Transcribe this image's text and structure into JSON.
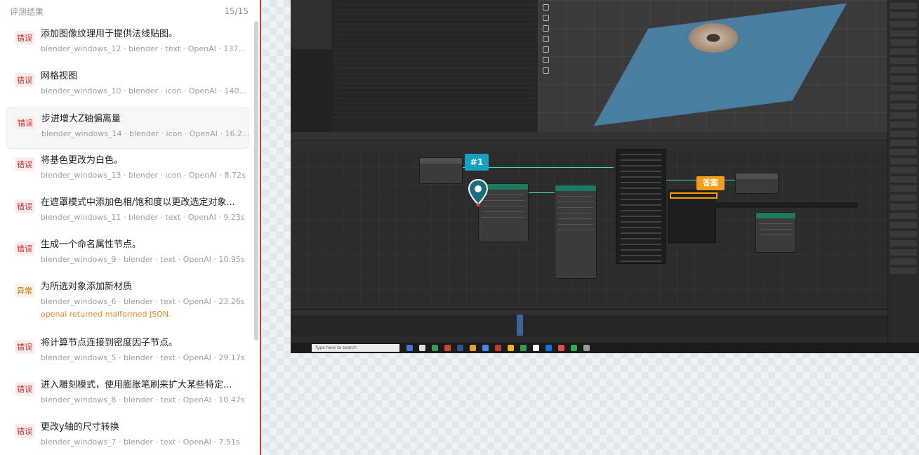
{
  "header": {
    "title": "评测结果",
    "count": "15/15"
  },
  "results": [
    {
      "status": "错误",
      "status_kind": "error",
      "title": "添加图像纹理用于提供法线贴图。",
      "meta": "blender_windows_12 · blender · text · OpenAI · 137...",
      "selected": false
    },
    {
      "status": "错误",
      "status_kind": "error",
      "title": "网格视图",
      "meta": "blender_windows_10 · blender · icon · OpenAI · 140...",
      "selected": false
    },
    {
      "status": "错误",
      "status_kind": "error",
      "title": "步进增大Z轴偏离量",
      "meta": "blender_windows_14 · blender · icon · OpenAI · 16.2...",
      "selected": true
    },
    {
      "status": "错误",
      "status_kind": "error",
      "title": "将基色更改为白色。",
      "meta": "blender_windows_13 · blender · icon · OpenAI · 8.72s",
      "selected": false
    },
    {
      "status": "错误",
      "status_kind": "error",
      "title": "在遮罩模式中添加色相/饱和度以更改选定对象...",
      "meta": "blender_windows_11 · blender · text · OpenAI · 9.23s",
      "selected": false
    },
    {
      "status": "错误",
      "status_kind": "error",
      "title": "生成一个命名属性节点。",
      "meta": "blender_windows_9 · blender · text · OpenAI · 10.95s",
      "selected": false
    },
    {
      "status": "异常",
      "status_kind": "warning",
      "title": "为所选对象添加新材质",
      "meta": "blender_windows_6 · blender · text · OpenAI · 23.26s",
      "error_message": "openai returned malformed JSON.",
      "selected": false
    },
    {
      "status": "错误",
      "status_kind": "error",
      "title": "将计算节点连接到密度因子节点。",
      "meta": "blender_windows_5 · blender · text · OpenAI · 29.17s",
      "selected": false
    },
    {
      "status": "错误",
      "status_kind": "error",
      "title": "进入雕刻模式，使用膨胀笔刷来扩大某些特定...",
      "meta": "blender_windows_8 · blender · text · OpenAI · 10.47s",
      "selected": false
    },
    {
      "status": "错误",
      "status_kind": "error",
      "title": "更改y轴的尺寸转换",
      "meta": "blender_windows_7 · blender · text · OpenAI · 7.51s",
      "selected": false
    }
  ],
  "preview": {
    "prediction_marker": "#1",
    "answer_marker": "答案",
    "taskbar_search_placeholder": "Type here to search"
  },
  "colors": {
    "error": "#d32f2f",
    "warning": "#b07414",
    "panel_border": "#e53935",
    "marker_blue": "#17a0c0",
    "answer_orange": "#f59d1e"
  }
}
